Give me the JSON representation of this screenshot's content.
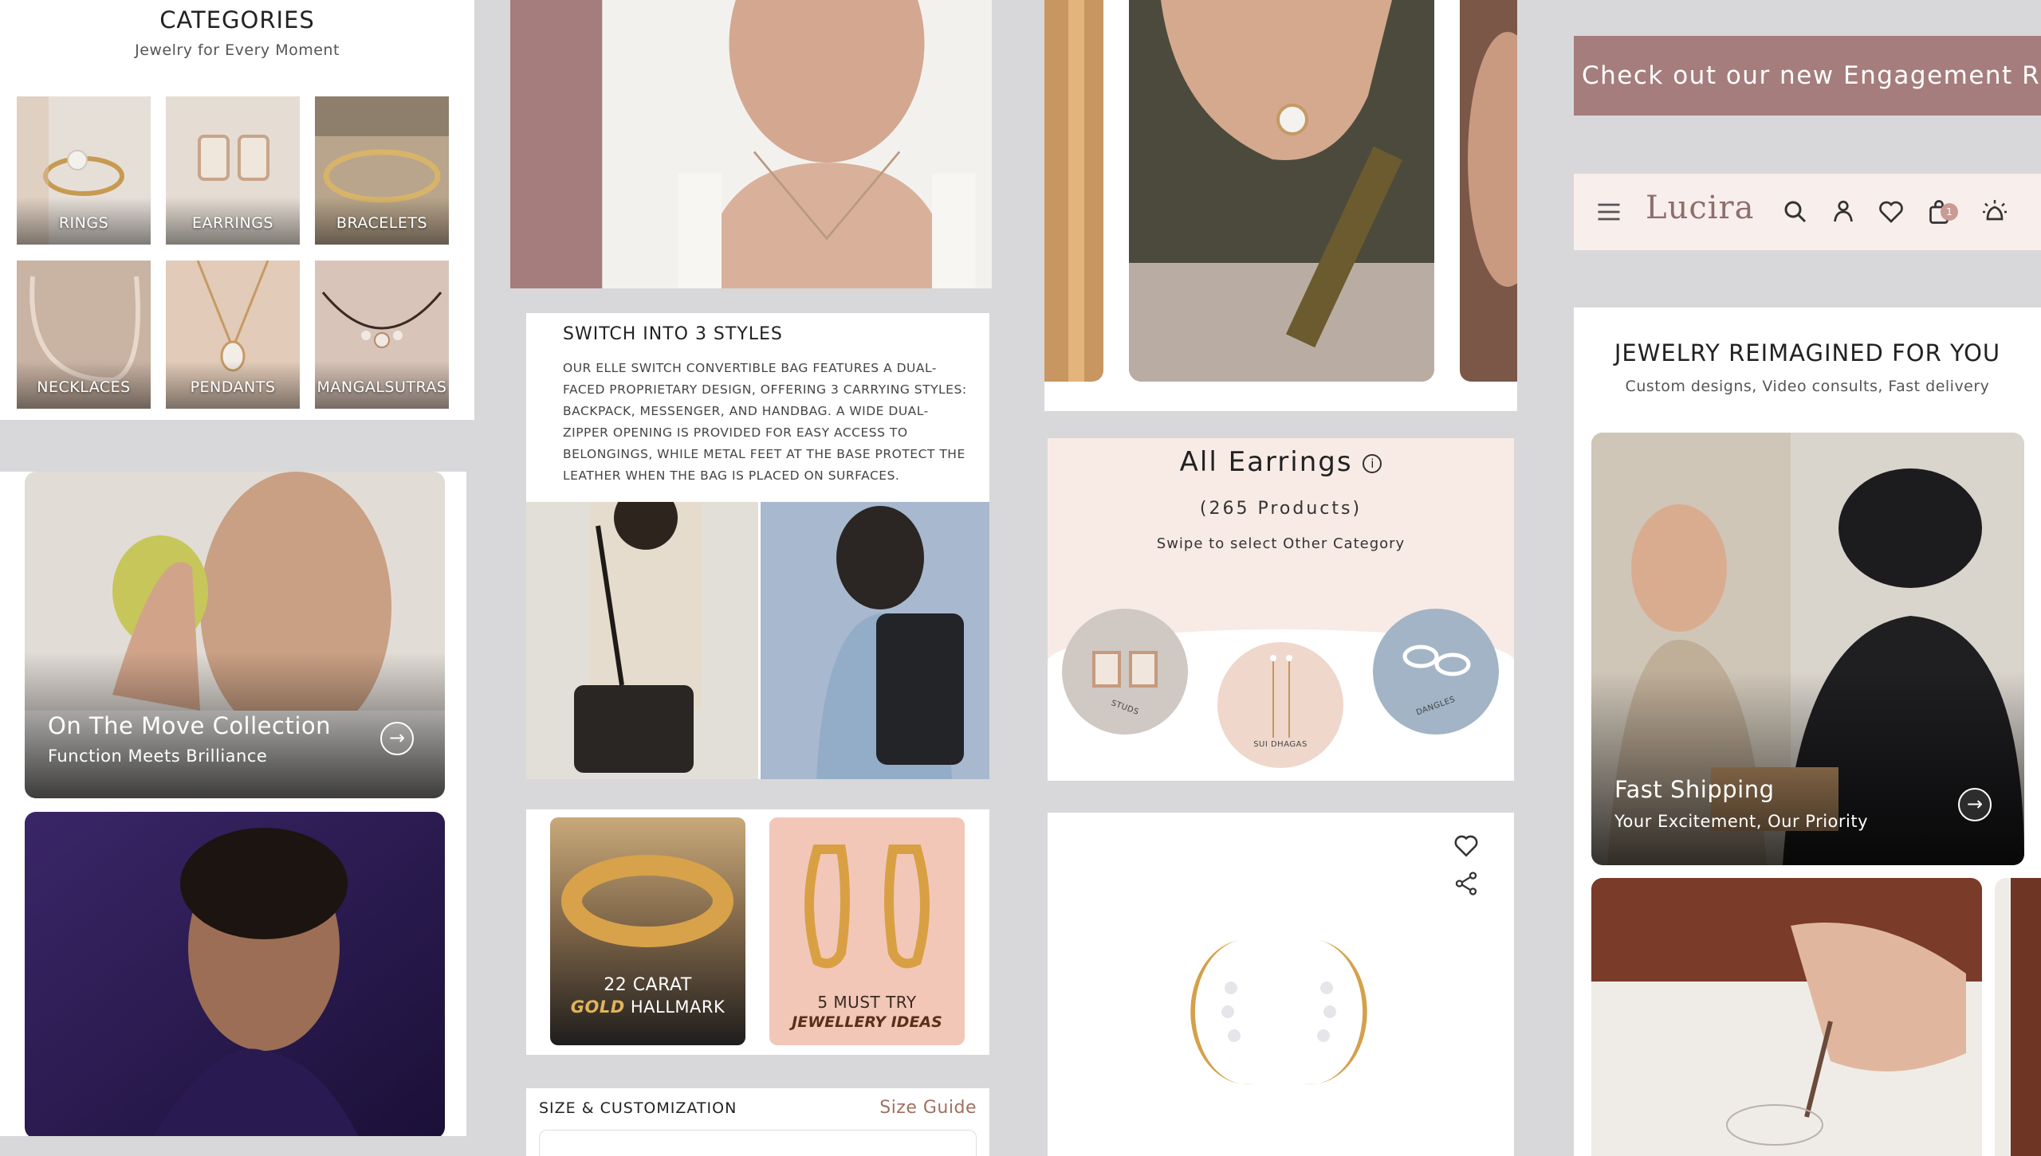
{
  "categories": {
    "title": "CATEGORIES",
    "subtitle": "Jewelry for Every Moment",
    "items": [
      {
        "label": "RINGS"
      },
      {
        "label": "EARRINGS"
      },
      {
        "label": "BRACELETS"
      },
      {
        "label": "NECKLACES"
      },
      {
        "label": "PENDANTS"
      },
      {
        "label": "MANGALSUTRAS"
      }
    ]
  },
  "collection": {
    "title": "On The Move Collection",
    "subtitle": "Function Meets Brilliance"
  },
  "switch_styles": {
    "title": "SWITCH INTO 3 STYLES",
    "body": "Our Elle Switch convertible bag features a dual-faced proprietary design, offering 3 carrying styles: backpack, messenger, and handbag. A wide dual-zipper opening is provided for easy access to belongings, while metal feet at the base protect the leather when the bag is placed on surfaces."
  },
  "promos": {
    "gold": {
      "line1": "22 CARAT",
      "line2_em": "GOLD",
      "line2": "HALLMARK"
    },
    "ideas": {
      "line1": "5 MUST TRY",
      "line2": "JEWELLERY IDEAS"
    }
  },
  "size": {
    "title": "SIZE & CUSTOMIZATION",
    "link": "Size Guide"
  },
  "earrings": {
    "title": "All Earrings",
    "count": "(265 Products)",
    "swipe": "Swipe to select Other Category",
    "circles": [
      {
        "label": "STUDS"
      },
      {
        "label": "SUI DHAGAS"
      },
      {
        "label": "DANGLES"
      }
    ]
  },
  "banner": {
    "text": "Check out our new Engagement Rings!"
  },
  "nav": {
    "logo": "Lucira",
    "cart_count": "1"
  },
  "reimagined": {
    "title": "JEWELRY REIMAGINED FOR YOU",
    "subtitle": "Custom designs, Video consults, Fast delivery"
  },
  "shipping": {
    "title": "Fast Shipping",
    "subtitle": "Your Excitement, Our Priority"
  },
  "colors": {
    "accent": "#a57d7c",
    "nav_bg": "#f8eeeb",
    "earring_bg": "#f8ebe6",
    "link": "#a07060"
  }
}
